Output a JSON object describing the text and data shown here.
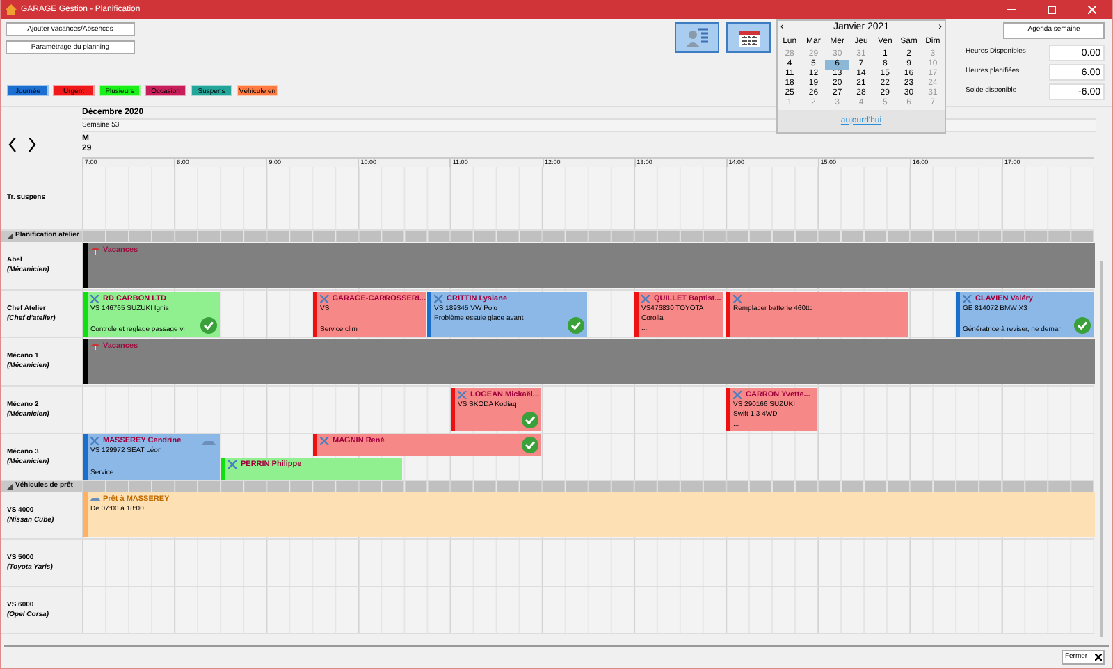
{
  "window": {
    "title": "GARAGE Gestion - Planification"
  },
  "buttons": [
    {
      "label": "Ajouter vacances/Absences"
    },
    {
      "label": "Paramétrage du planning"
    }
  ],
  "legend": [
    {
      "label": "Journée",
      "color": "#1a6fd0"
    },
    {
      "label": "Urgent",
      "color": "#f01818"
    },
    {
      "label": "Plusieurs",
      "color": "#18f018"
    },
    {
      "label": "Occasion",
      "color": "#c81e5a"
    },
    {
      "label": "Suspens",
      "color": "#24a59a"
    },
    {
      "label": "Véhicule en",
      "color": "#ff7a40"
    }
  ],
  "calendar": {
    "month": "Janvier 2021",
    "prev": "‹",
    "next": "›",
    "weekdays": [
      "Lun",
      "Mar",
      "Mer",
      "Jeu",
      "Ven",
      "Sam",
      "Dim"
    ],
    "weeks": [
      [
        {
          "day": "28",
          "outside": true,
          "selected": false
        },
        {
          "day": "29",
          "outside": true,
          "selected": false
        },
        {
          "day": "30",
          "outside": true,
          "selected": false
        },
        {
          "day": "31",
          "outside": true,
          "selected": false
        },
        {
          "day": "1",
          "outside": false,
          "selected": false
        },
        {
          "day": "2",
          "outside": false,
          "selected": false
        },
        {
          "day": "3",
          "outside": true,
          "selected": false
        }
      ],
      [
        {
          "day": "4",
          "outside": false,
          "selected": false
        },
        {
          "day": "5",
          "outside": false,
          "selected": false
        },
        {
          "day": "6",
          "outside": false,
          "selected": true
        },
        {
          "day": "7",
          "outside": false,
          "selected": false
        },
        {
          "day": "8",
          "outside": false,
          "selected": false
        },
        {
          "day": "9",
          "outside": false,
          "selected": false
        },
        {
          "day": "10",
          "outside": true,
          "selected": false
        }
      ],
      [
        {
          "day": "11",
          "outside": false,
          "selected": false
        },
        {
          "day": "12",
          "outside": false,
          "selected": false
        },
        {
          "day": "13",
          "outside": false,
          "selected": false
        },
        {
          "day": "14",
          "outside": false,
          "selected": false
        },
        {
          "day": "15",
          "outside": false,
          "selected": false
        },
        {
          "day": "16",
          "outside": false,
          "selected": false
        },
        {
          "day": "17",
          "outside": true,
          "selected": false
        }
      ],
      [
        {
          "day": "18",
          "outside": false,
          "selected": false
        },
        {
          "day": "19",
          "outside": false,
          "selected": false
        },
        {
          "day": "20",
          "outside": false,
          "selected": false
        },
        {
          "day": "21",
          "outside": false,
          "selected": false
        },
        {
          "day": "22",
          "outside": false,
          "selected": false
        },
        {
          "day": "23",
          "outside": false,
          "selected": false
        },
        {
          "day": "24",
          "outside": true,
          "selected": false
        }
      ],
      [
        {
          "day": "25",
          "outside": false,
          "selected": false
        },
        {
          "day": "26",
          "outside": false,
          "selected": false
        },
        {
          "day": "27",
          "outside": false,
          "selected": false
        },
        {
          "day": "28",
          "outside": false,
          "selected": false
        },
        {
          "day": "29",
          "outside": false,
          "selected": false
        },
        {
          "day": "30",
          "outside": false,
          "selected": false
        },
        {
          "day": "31",
          "outside": true,
          "selected": false
        }
      ],
      [
        {
          "day": "1",
          "outside": true,
          "selected": false
        },
        {
          "day": "2",
          "outside": true,
          "selected": false
        },
        {
          "day": "3",
          "outside": true,
          "selected": false
        },
        {
          "day": "4",
          "outside": true,
          "selected": false
        },
        {
          "day": "5",
          "outside": true,
          "selected": false
        },
        {
          "day": "6",
          "outside": true,
          "selected": false
        },
        {
          "day": "7",
          "outside": true,
          "selected": false
        }
      ]
    ],
    "today_link": "aujourd'hui"
  },
  "agenda_button": "Agenda semaine",
  "totals": [
    {
      "label": "Heures Disponibles",
      "value": "0.00"
    },
    {
      "label": "Heures planifiées",
      "value": "6.00"
    },
    {
      "label": "Solde disponible",
      "value": "-6.00"
    }
  ],
  "planning": {
    "month": "Décembre 2020",
    "week": "Semaine 53",
    "day_letter": "M",
    "day_number": "29",
    "hours": [
      "7:00",
      "8:00",
      "9:00",
      "10:00",
      "11:00",
      "12:00",
      "13:00",
      "14:00",
      "15:00",
      "16:00",
      "17:00"
    ],
    "sections": [
      {
        "kind": "plain",
        "rows": [
          {
            "name": "Tr. suspens",
            "events": []
          }
        ]
      },
      {
        "kind": "group",
        "title": "Planification atelier",
        "expanded": true,
        "rows": [
          {
            "name": "Abel",
            "role": "(Mécanicien)",
            "events": [
              {
                "kind": "vacances",
                "title": "Vacances"
              }
            ]
          },
          {
            "name": "Chef Atelier",
            "role": "(Chef d'atelier)",
            "events": [
              {
                "kind": "plusieurs",
                "title": "RD CARBON LTD",
                "lines": [
                  "VS 146765 SUZUKI Ignis"
                ],
                "footer": "Controle et reglage passage vi",
                "done": true
              },
              {
                "kind": "urgent",
                "title": "GARAGE-CARROSSERI...",
                "lines": [
                  "VS"
                ],
                "footer": "Service clim",
                "done": false
              },
              {
                "kind": "journee",
                "title": "CRITTIN Lysiane",
                "lines": [
                  "VS 189345 VW Polo",
                  "Problème essuie glace avant"
                ],
                "done": true
              },
              {
                "kind": "urgent",
                "title": "QUILLET Baptist...",
                "lines": [
                  "VS476830 TOYOTA",
                  "Corolla",
                  "..."
                ],
                "done": false
              },
              {
                "kind": "urgent",
                "lines": [
                  "Remplacer batterie 460ttc"
                ],
                "done": false
              },
              {
                "kind": "journee",
                "title": "CLAVIEN Valéry",
                "lines": [
                  "GE 814072 BMW X3"
                ],
                "footer": "Génératrice à reviser, ne demar",
                "done": true
              }
            ]
          },
          {
            "name": "Mécano 1",
            "role": "(Mécanicien)",
            "events": [
              {
                "kind": "vacances",
                "title": "Vacances"
              }
            ]
          },
          {
            "name": "Mécano 2",
            "role": "(Mécanicien)",
            "events": [
              {
                "kind": "urgent",
                "title": "LOGEAN Mickaël...",
                "lines": [
                  "VS SKODA Kodiaq"
                ],
                "done": true
              },
              {
                "kind": "urgent",
                "title": "CARRON Yvette...",
                "lines": [
                  "VS 290166 SUZUKI",
                  "Swift 1.3 4WD",
                  "..."
                ],
                "done": false
              }
            ]
          },
          {
            "name": "Mécano 3",
            "role": "(Mécanicien)",
            "events": [
              {
                "kind": "journee",
                "title": "MASSEREY Cendrine",
                "lines": [
                  "VS 129972 SEAT Léon"
                ],
                "footer": "Service",
                "done": false,
                "loan_car": true
              },
              {
                "kind": "urgent",
                "title": "MAGNIN René",
                "done": true
              },
              {
                "kind": "plusieurs",
                "title": "PERRIN Philippe",
                "done": false
              }
            ]
          }
        ]
      },
      {
        "kind": "group",
        "title": "Véhicules de prêt",
        "expanded": true,
        "rows": [
          {
            "name": "VS 4000",
            "role": "(Nissan Cube)",
            "events": [
              {
                "kind": "pret",
                "title": "Prêt à MASSEREY",
                "lines": [
                  "De 07:00 à 18:00"
                ]
              }
            ]
          },
          {
            "name": "VS 5000",
            "role": "(Toyota Yaris)",
            "events": []
          },
          {
            "name": "VS 6000",
            "role": "(Opel Corsa)",
            "events": []
          }
        ]
      }
    ]
  },
  "close_button": "Fermer"
}
